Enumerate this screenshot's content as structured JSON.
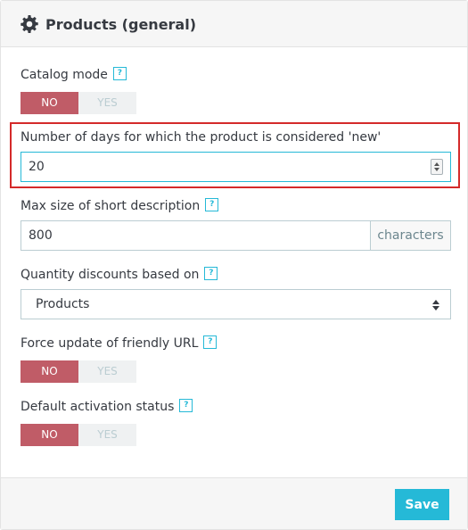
{
  "panel": {
    "title": "Products (general)",
    "icon": "gear-icon"
  },
  "fields": {
    "catalog_mode": {
      "label": "Catalog mode",
      "help": "?",
      "no_label": "NO",
      "yes_label": "YES",
      "selected": "NO"
    },
    "new_days": {
      "label": "Number of days for which the product is considered 'new'",
      "value": "20"
    },
    "short_desc_max": {
      "label": "Max size of short description",
      "help": "?",
      "value": "800",
      "suffix": "characters"
    },
    "qty_discounts": {
      "label": "Quantity discounts based on",
      "help": "?",
      "selected": "Products"
    },
    "force_friendly_url": {
      "label": "Force update of friendly URL",
      "help": "?",
      "no_label": "NO",
      "yes_label": "YES",
      "selected": "NO"
    },
    "default_activation": {
      "label": "Default activation status",
      "help": "?",
      "no_label": "NO",
      "yes_label": "YES",
      "selected": "NO"
    }
  },
  "footer": {
    "save_label": "Save"
  },
  "colors": {
    "accent": "#25b9d7",
    "switch_off": "#c05c67",
    "highlight": "#d42a2a"
  }
}
